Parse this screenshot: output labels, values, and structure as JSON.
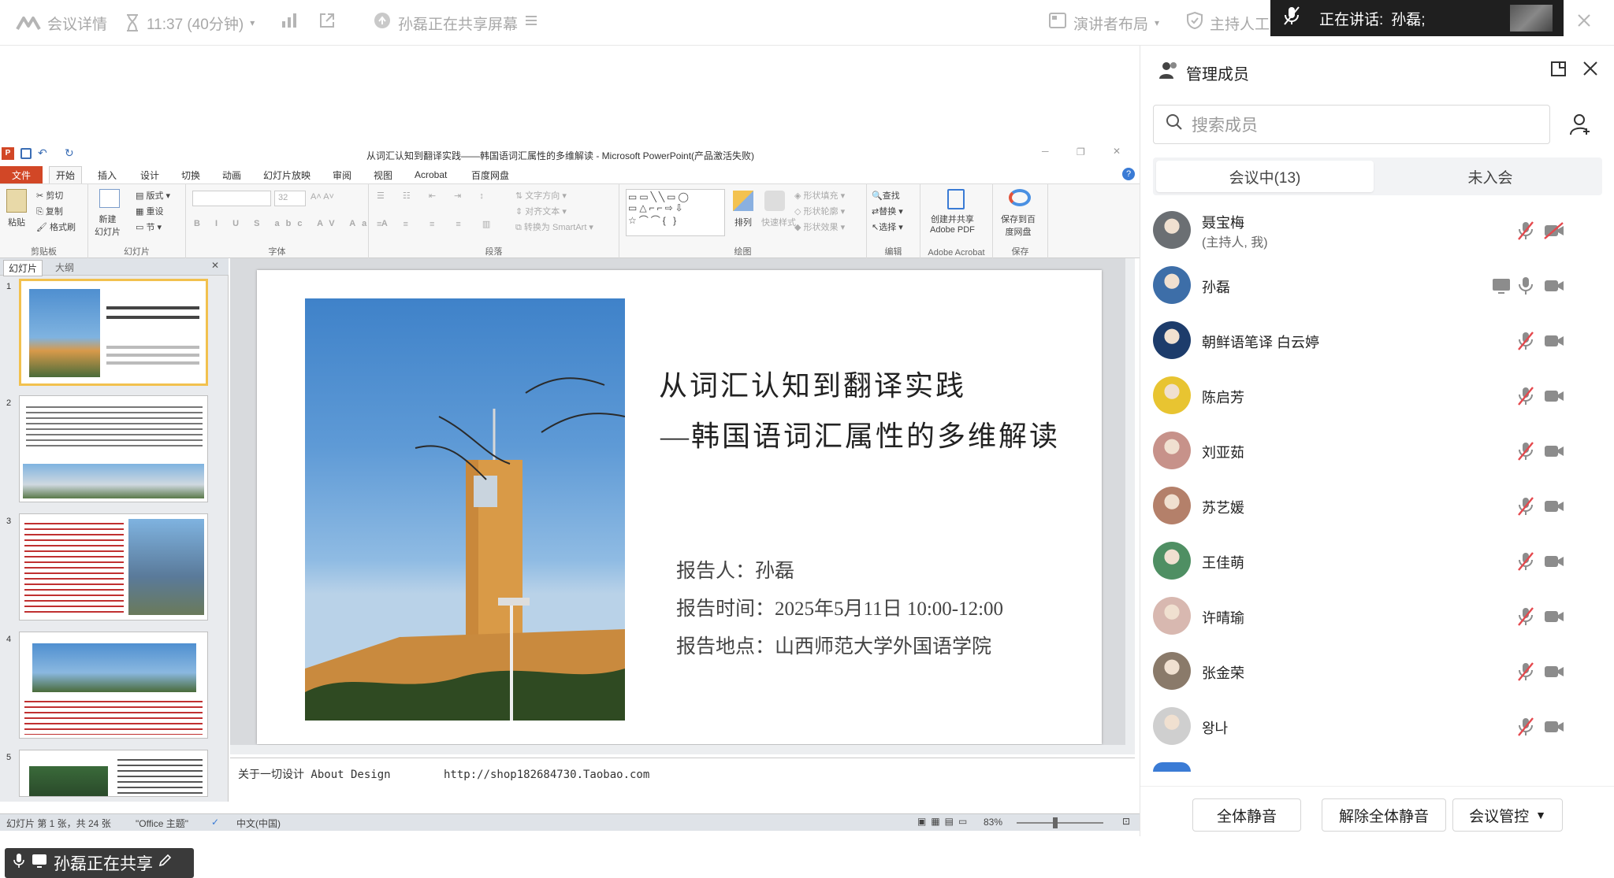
{
  "topbar": {
    "meeting_details": "会议详情",
    "timer": "11:37 (40分钟)",
    "sharing_status": "孙磊正在共享屏幕",
    "speaker_layout": "演讲者布局",
    "host_ai": "主持人工",
    "speaking_label": "正在讲话:",
    "speaking_name": "孙磊;"
  },
  "ppt": {
    "window_title": "从词汇认知到翻译实践——韩国语词汇属性的多维解读 - Microsoft PowerPoint(产品激活失败)",
    "tabs": [
      "文件",
      "开始",
      "插入",
      "设计",
      "切换",
      "动画",
      "幻灯片放映",
      "审阅",
      "视图",
      "Acrobat",
      "百度网盘"
    ],
    "active_tab": "开始",
    "ribbon": {
      "clipboard": {
        "paste": "粘贴",
        "cut": "剪切",
        "copy": "复制",
        "format_painter": "格式刷",
        "label": "剪贴板"
      },
      "slides": {
        "new_slide": "新建\n幻灯片",
        "layout": "版式",
        "reset": "重设",
        "section": "节",
        "label": "幻灯片"
      },
      "font": {
        "size": "32",
        "label": "字体"
      },
      "paragraph": {
        "text_direction": "文字方向",
        "align_text": "对齐文本",
        "smartart": "转换为 SmartArt",
        "label": "段落"
      },
      "drawing": {
        "arrange": "排列",
        "quick_styles": "快速样式",
        "fill": "形状填充",
        "outline": "形状轮廓",
        "effects": "形状效果",
        "label": "绘图"
      },
      "editing": {
        "find": "查找",
        "replace": "替换",
        "select": "选择",
        "label": "编辑"
      },
      "acrobat": {
        "create_pdf": "创建并共享\nAdobe PDF",
        "label": "Adobe Acrobat"
      },
      "save": {
        "save_baidu": "保存到百\n度网盘",
        "label": "保存"
      }
    },
    "pane_tabs": [
      "幻灯片",
      "大纲"
    ],
    "thumb_numbers": [
      "1",
      "2",
      "3",
      "4",
      "5"
    ],
    "slide": {
      "title_line1": "从词汇认知到翻译实践",
      "title_line2": "—韩国语词汇属性的多维解读",
      "reporter": "报告人：孙磊",
      "time": "报告时间：2025年5月11日 10:00-12:00",
      "place": "报告地点：山西师范大学外国语学院"
    },
    "notes": "关于一切设计 About Design        http://shop182684730.Taobao.com",
    "status_slide": "幻灯片 第 1 张，共 24 张",
    "status_theme": "\"Office 主题\"",
    "status_lang": "中文(中国)",
    "zoom": "83%"
  },
  "share_badge": "孙磊正在共享",
  "panel": {
    "title": "管理成员",
    "search_placeholder": "搜索成员",
    "tab_in_meeting": "会议中(13)",
    "tab_not_joined": "未入会",
    "members": [
      {
        "name": "聂宝梅",
        "sub": "(主持人, 我)",
        "avatar_color": "#6b6f73",
        "mic": "muted",
        "cam": "off"
      },
      {
        "name": "孙磊",
        "sub": "",
        "avatar_color": "#3d6ea8",
        "mic": "on",
        "cam": "on",
        "sharing": true
      },
      {
        "name": "朝鲜语笔译 白云婷",
        "sub": "",
        "avatar_color": "#1d3c6b",
        "mic": "muted",
        "cam": "on"
      },
      {
        "name": "陈启芳",
        "sub": "",
        "avatar_color": "#e8c431",
        "mic": "muted",
        "cam": "on"
      },
      {
        "name": "刘亚茹",
        "sub": "",
        "avatar_color": "#c7928a",
        "mic": "muted",
        "cam": "on"
      },
      {
        "name": "苏艺媛",
        "sub": "",
        "avatar_color": "#b4806a",
        "mic": "muted",
        "cam": "on"
      },
      {
        "name": "王佳萌",
        "sub": "",
        "avatar_color": "#4f8f63",
        "mic": "muted",
        "cam": "on"
      },
      {
        "name": "许晴瑜",
        "sub": "",
        "avatar_color": "#d8b8b0",
        "mic": "muted",
        "cam": "on"
      },
      {
        "name": "张金荣",
        "sub": "",
        "avatar_color": "#8a7a6a",
        "mic": "muted",
        "cam": "on"
      },
      {
        "name": "왕나",
        "sub": "",
        "avatar_color": "#cfcfcf",
        "mic": "muted",
        "cam": "on"
      }
    ],
    "btn_mute_all": "全体静音",
    "btn_unmute_all": "解除全体静音",
    "btn_control": "会议管控"
  },
  "colors": {
    "accent": "#1a73e8",
    "muted_red": "#e5484d",
    "icon_gray": "#8c8c8c",
    "ppt_file_tab": "#d24726"
  }
}
